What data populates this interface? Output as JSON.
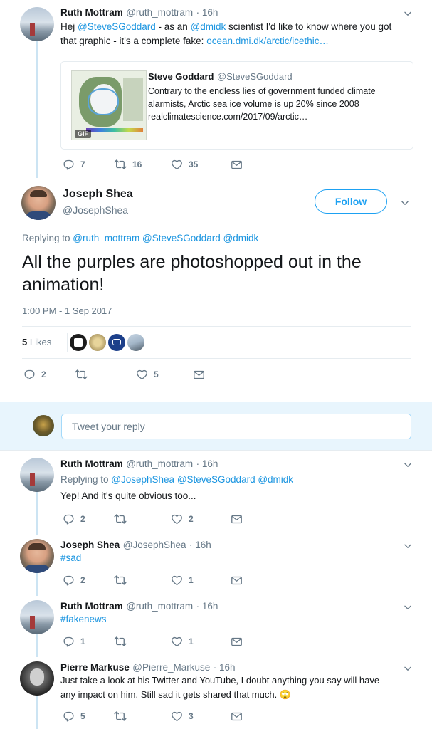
{
  "top_tweet": {
    "name": "Ruth Mottram",
    "handle": "@ruth_mottram",
    "time": "· 16h",
    "text_parts": {
      "p1": "Hej ",
      "mention1": "@SteveSGoddard",
      "p2": " - as an ",
      "mention2": "@dmidk",
      "p3": " scientist I'd like to know where you got",
      "line2": "that graphic - it's a complete fake: ",
      "link": "ocean.dmi.dk/arctic/icethic…"
    },
    "quoted": {
      "name": "Steve Goddard",
      "handle": "@SteveSGoddard",
      "line1": "Contrary to the endless lies of government funded climate",
      "line2": "alarmists, Arctic sea ice volume is up 20% since 2008",
      "line3": "realclimatescience.com/2017/09/arctic…",
      "gif_label": "GIF"
    },
    "replies": "7",
    "retweets": "16",
    "likes": "35"
  },
  "main_tweet": {
    "name": "Joseph Shea",
    "handle": "@JosephShea",
    "follow_label": "Follow",
    "replying_prefix": "Replying to ",
    "replying_to": [
      "@ruth_mottram",
      "@SteveSGoddard",
      "@dmidk"
    ],
    "text_line1": "All the purples are photoshopped out in the",
    "text_line2": "animation!",
    "timestamp": "1:00 PM - 1 Sep 2017",
    "likes_count": "5",
    "likes_label": "Likes",
    "replies": "2",
    "retweets": "",
    "likes": "5"
  },
  "reply_box": {
    "placeholder": "Tweet your reply"
  },
  "replies": [
    {
      "name": "Ruth Mottram",
      "handle": "@ruth_mottram",
      "time": "· 16h",
      "replying_prefix": "Replying to ",
      "replying_to": "@JosephShea @SteveSGoddard @dmidk",
      "text": "Yep! And it's quite obvious too...",
      "replies": "2",
      "likes": "2"
    },
    {
      "name": "Joseph Shea",
      "handle": "@JosephShea",
      "time": "· 16h",
      "hashtag": "#sad",
      "replies": "2",
      "likes": "1"
    },
    {
      "name": "Ruth Mottram",
      "handle": "@ruth_mottram",
      "time": "· 16h",
      "hashtag": "#fakenews",
      "replies": "1",
      "likes": "1"
    },
    {
      "name": "Pierre Markuse",
      "handle": "@Pierre_Markuse",
      "time": "· 16h",
      "line1": "Just take a look at his Twitter and YouTube, I doubt anything you say will have",
      "line2": "any impact on him. Still sad it gets shared that much.",
      "emoji": "🙄",
      "replies": "5",
      "likes": "3"
    }
  ]
}
